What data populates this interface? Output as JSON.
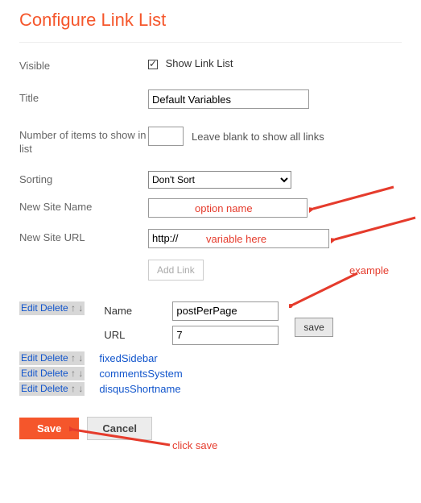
{
  "header": {
    "title": "Configure Link List"
  },
  "visible": {
    "label": "Visible",
    "checkbox_label": "Show Link List"
  },
  "title_field": {
    "label": "Title",
    "value": "Default Variables"
  },
  "num_items": {
    "label": "Number of items to show in list",
    "value": "",
    "hint": "Leave blank to show all links"
  },
  "sorting": {
    "label": "Sorting",
    "selected": "Don't Sort"
  },
  "new_site_name": {
    "label": "New Site Name",
    "value": ""
  },
  "new_site_url": {
    "label": "New Site URL",
    "value": "http://"
  },
  "add_link_btn": "Add Link",
  "edit_entry": {
    "actions": "Edit Delete",
    "arrows": "↑ ↓",
    "name_label": "Name",
    "name_value": "postPerPage",
    "url_label": "URL",
    "url_value": "7",
    "save_btn": "save"
  },
  "entries": [
    {
      "actions": "Edit Delete",
      "arrows": "↑ ↓",
      "name": "fixedSidebar"
    },
    {
      "actions": "Edit Delete",
      "arrows": "↑ ↓",
      "name": "commentsSystem"
    },
    {
      "actions": "Edit Delete",
      "arrows": "↑ ↓",
      "name": "disqusShortname"
    }
  ],
  "bottom": {
    "save": "Save",
    "cancel": "Cancel"
  },
  "annotations": {
    "option_name": "option name",
    "variable_here": "variable here",
    "example": "example",
    "click_save": "click save"
  }
}
